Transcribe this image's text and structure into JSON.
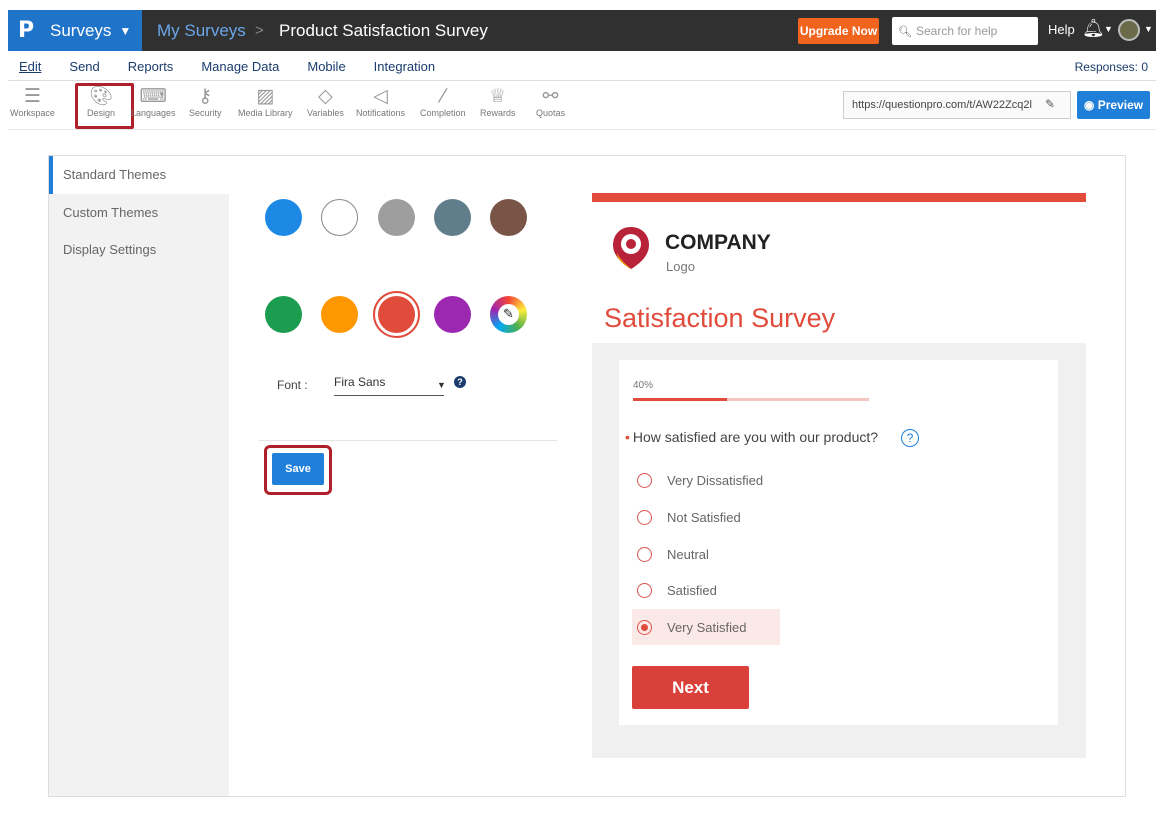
{
  "topbar": {
    "brand_logo": "P",
    "brand_label": "Surveys",
    "breadcrumb_parent": "My Surveys",
    "breadcrumb_sep": ">",
    "breadcrumb_current": "Product Satisfaction Survey",
    "upgrade_label": "Upgrade Now",
    "search_placeholder": "Search for help",
    "help_label": "Help",
    "brand_color": "#1f73c9",
    "upgrade_color": "#f0641e"
  },
  "menu": {
    "items": [
      "Edit",
      "Send",
      "Reports",
      "Manage Data",
      "Mobile",
      "Integration"
    ],
    "responses_label": "Responses: 0"
  },
  "toolbar": {
    "items": [
      {
        "label": "Workspace",
        "icon": "workspace-icon"
      },
      {
        "label": "Design",
        "icon": "palette-icon"
      },
      {
        "label": "Languages",
        "icon": "keyboard-icon"
      },
      {
        "label": "Security",
        "icon": "key-icon"
      },
      {
        "label": "Media Library",
        "icon": "image-icon"
      },
      {
        "label": "Variables",
        "icon": "tag-icon"
      },
      {
        "label": "Notifications",
        "icon": "megaphone-icon"
      },
      {
        "label": "Completion",
        "icon": "wand-icon"
      },
      {
        "label": "Rewards",
        "icon": "trophy-icon"
      },
      {
        "label": "Quotas",
        "icon": "quota-icon"
      }
    ],
    "selected": "Design",
    "survey_url": "https://questionpro.com/t/AW22Zcq2l",
    "preview_label": "Preview"
  },
  "sidebar": {
    "items": [
      "Standard Themes",
      "Custom Themes",
      "Display Settings"
    ],
    "active": "Standard Themes"
  },
  "themes": {
    "swatches": [
      {
        "name": "blue",
        "color": "#1e88e5"
      },
      {
        "name": "white",
        "color": "#ffffff"
      },
      {
        "name": "gray",
        "color": "#9e9e9e"
      },
      {
        "name": "slate",
        "color": "#607d8b"
      },
      {
        "name": "brown",
        "color": "#795548"
      },
      {
        "name": "green",
        "color": "#1b9c4e"
      },
      {
        "name": "orange",
        "color": "#ff9800"
      },
      {
        "name": "red",
        "color": "#e04b3b"
      },
      {
        "name": "purple",
        "color": "#9c27b0"
      },
      {
        "name": "custom",
        "color": "multicolor"
      }
    ],
    "selected": "red",
    "font_label": "Font :",
    "font_value": "Fira Sans",
    "save_label": "Save"
  },
  "preview": {
    "logo_company": "COMPANY",
    "logo_sub": "Logo",
    "title": "Satisfaction Survey",
    "progress_text": "40%",
    "progress_value": 0.4,
    "question": "How satisfied are you with our product?",
    "required_mark": "•",
    "help_mark": "?",
    "options": [
      "Very Dissatisfied",
      "Not Satisfied",
      "Neutral",
      "Satisfied",
      "Very Satisfied"
    ],
    "selected_option": "Very Satisfied",
    "next_label": "Next",
    "accent_color": "#e04b3b"
  }
}
